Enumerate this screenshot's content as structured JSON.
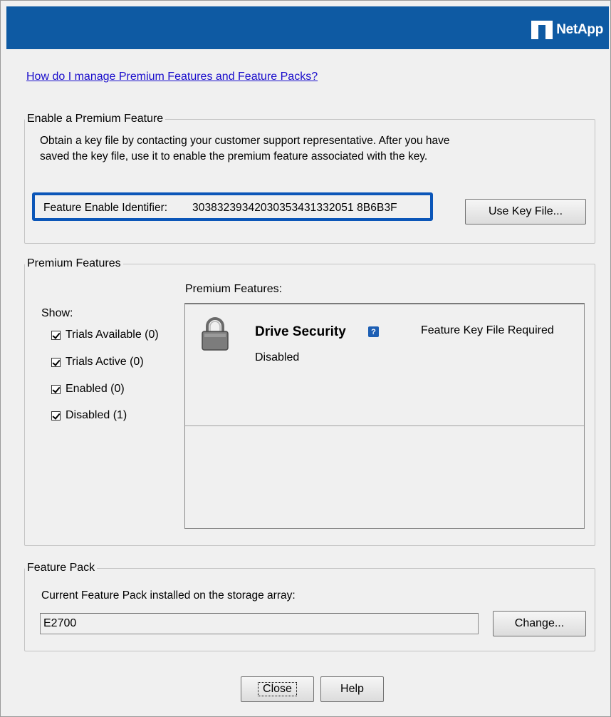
{
  "brand": {
    "name": "NetApp"
  },
  "help_link": "How do I manage Premium Features and Feature Packs?",
  "enable_section": {
    "legend": "Enable a Premium Feature",
    "description": "Obtain a key file by contacting your customer support representative. After you have saved the key file, use it to enable the premium feature associated with the key.",
    "identifier_label": "Feature Enable Identifier:",
    "identifier_value": "30383239342030353431332051 8B6B3F",
    "use_key_button": "Use Key File..."
  },
  "premium_section": {
    "legend": "Premium Features",
    "show_label": "Show:",
    "filters": [
      {
        "label": "Trials Available (0)",
        "checked": true
      },
      {
        "label": "Trials Active (0)",
        "checked": true
      },
      {
        "label": "Enabled (0)",
        "checked": true
      },
      {
        "label": "Disabled (1)",
        "checked": true
      }
    ],
    "list_title": "Premium Features:",
    "features": [
      {
        "name": "Drive Security",
        "help_icon": "question-icon",
        "requirement": "Feature Key File Required",
        "status": "Disabled",
        "icon": "lock-icon"
      }
    ]
  },
  "feature_pack": {
    "legend": "Feature Pack",
    "label": "Current Feature Pack installed on the storage array:",
    "value": "E2700",
    "change_button": "Change..."
  },
  "footer": {
    "close_button": "Close",
    "help_button": "Help"
  },
  "colors": {
    "banner": "#0e5aa3",
    "highlight_border": "#0b56b8",
    "link": "#1a0dcc"
  }
}
